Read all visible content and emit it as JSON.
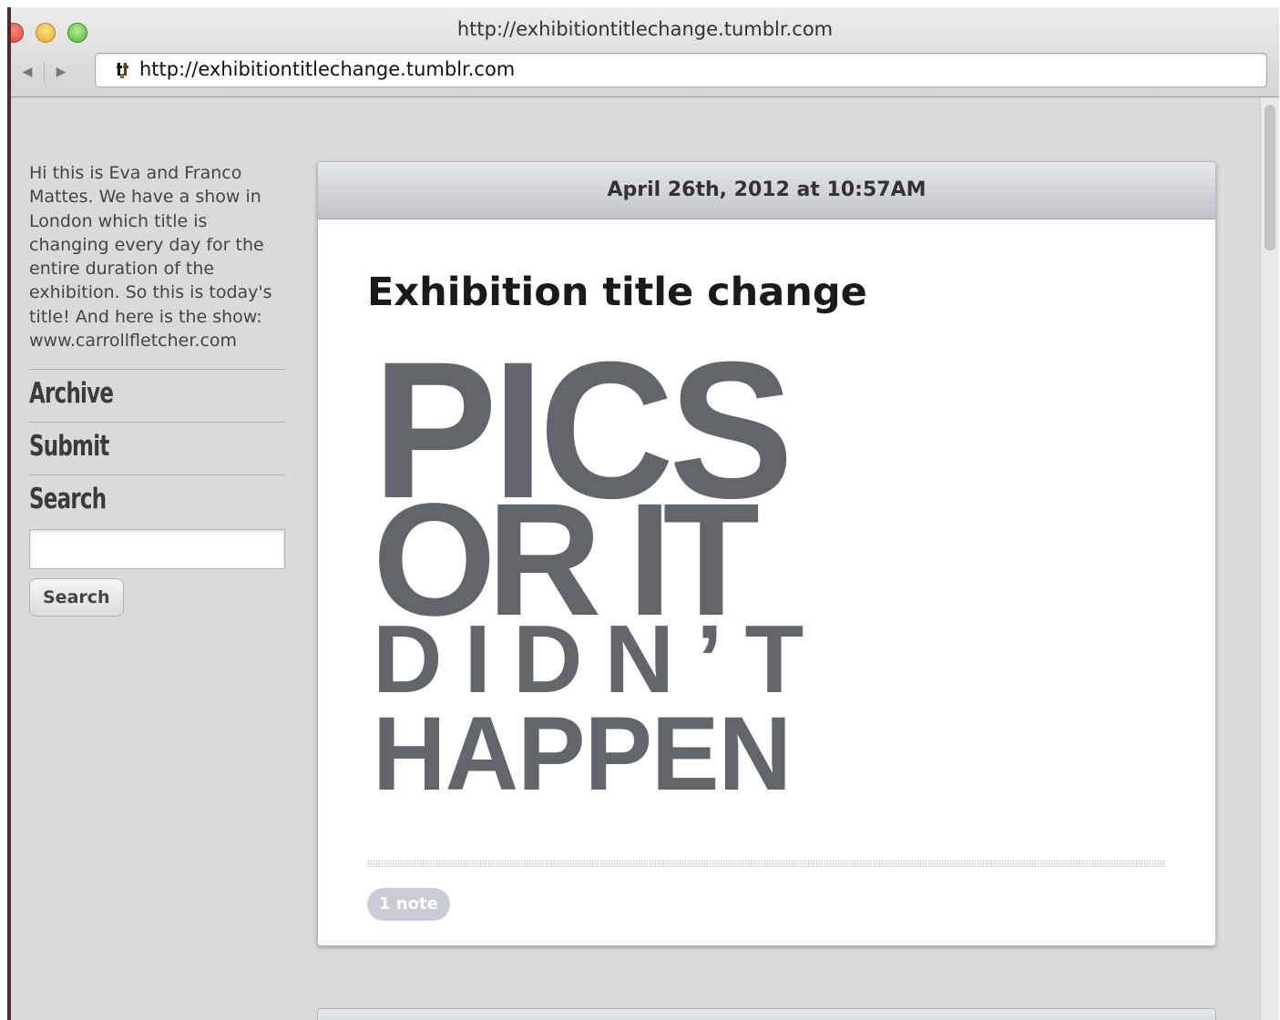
{
  "window": {
    "title": "http://exhibitiontitlechange.tumblr.com"
  },
  "toolbar": {
    "back_icon": "back-arrow-icon",
    "forward_icon": "forward-arrow-icon",
    "url": "http://exhibitiontitlechange.tumblr.com",
    "favicon": "tumblr-favicon-icon"
  },
  "sidebar": {
    "description": "Hi this is Eva and Franco Mattes. We have a show in London which title is changing every day for the entire duration of the exhibition. So this is today's title! And here is the show: www.carrollfletcher.com",
    "nav": [
      {
        "label": "Archive"
      },
      {
        "label": "Submit"
      },
      {
        "label": "Search"
      }
    ],
    "search_placeholder": "",
    "search_button": "Search"
  },
  "post": {
    "date": "April 26th, 2012 at 10:57AM",
    "title": "Exhibition title change",
    "image_lines": [
      "PICS",
      "OR IT",
      "DIDN’T",
      "HAPPEN"
    ],
    "notes": "1 note"
  },
  "colors": {
    "image_text": "#626569",
    "note_badge": "#c9ced6",
    "page_bg": "#dadada"
  }
}
